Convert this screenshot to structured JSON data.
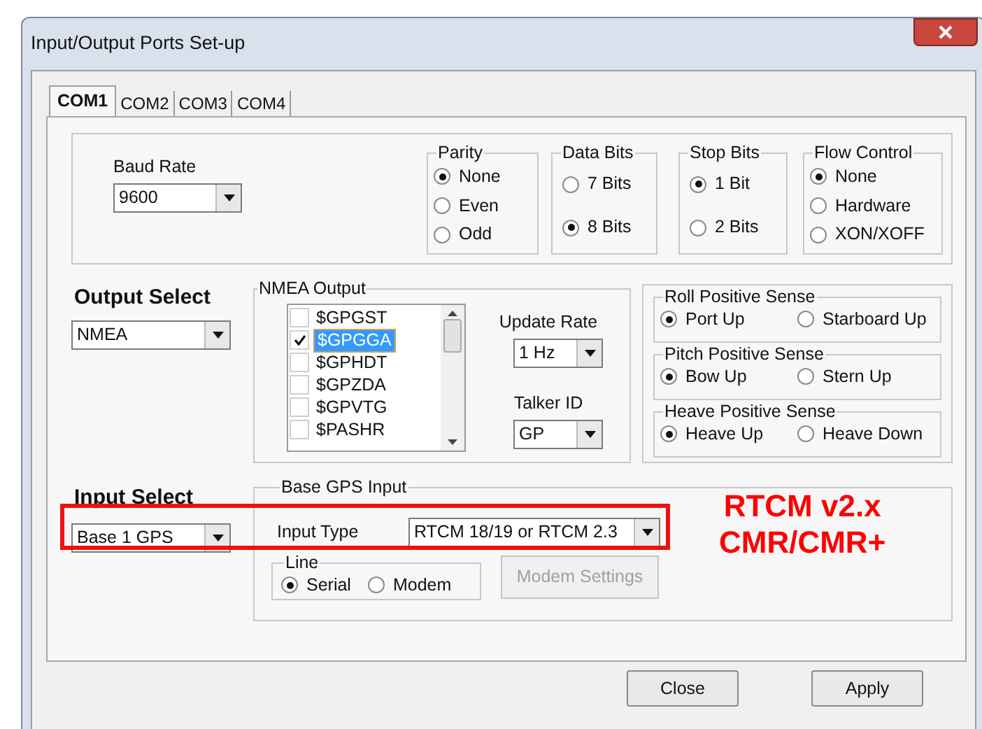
{
  "window": {
    "title": "Input/Output Ports Set-up"
  },
  "tabs": [
    {
      "label": "COM1",
      "selected": true
    },
    {
      "label": "COM2",
      "selected": false
    },
    {
      "label": "COM3",
      "selected": false
    },
    {
      "label": "COM4",
      "selected": false
    }
  ],
  "baud_rate": {
    "label": "Baud Rate",
    "value": "9600"
  },
  "port_groups": [
    {
      "title": "Parity",
      "options": [
        {
          "label": "None",
          "selected": true
        },
        {
          "label": "Even",
          "selected": false
        },
        {
          "label": "Odd",
          "selected": false
        }
      ]
    },
    {
      "title": "Data Bits",
      "options": [
        {
          "label": "7 Bits",
          "selected": false
        },
        {
          "label": "8 Bits",
          "selected": true
        }
      ]
    },
    {
      "title": "Stop Bits",
      "options": [
        {
          "label": "1 Bit",
          "selected": true
        },
        {
          "label": "2 Bits",
          "selected": false
        }
      ]
    },
    {
      "title": "Flow Control",
      "options": [
        {
          "label": "None",
          "selected": true
        },
        {
          "label": "Hardware",
          "selected": false
        },
        {
          "label": "XON/XOFF",
          "selected": false
        }
      ]
    }
  ],
  "output_select": {
    "label": "Output Select",
    "value": "NMEA"
  },
  "nmea_output": {
    "title": "NMEA Output",
    "items": [
      {
        "label": "$GPGST",
        "checked": false,
        "selected": false
      },
      {
        "label": "$GPGGA",
        "checked": true,
        "selected": true
      },
      {
        "label": "$GPHDT",
        "checked": false,
        "selected": false
      },
      {
        "label": "$GPZDA",
        "checked": false,
        "selected": false
      },
      {
        "label": "$GPVTG",
        "checked": false,
        "selected": false
      },
      {
        "label": "$PASHR",
        "checked": false,
        "selected": false
      }
    ]
  },
  "update_rate": {
    "label": "Update Rate",
    "value": "1 Hz"
  },
  "talker_id": {
    "label": "Talker ID",
    "value": "GP"
  },
  "sense_groups": [
    {
      "title": "Roll Positive Sense",
      "options": [
        {
          "label": "Port Up",
          "selected": true
        },
        {
          "label": "Starboard Up",
          "selected": false
        }
      ]
    },
    {
      "title": "Pitch Positive Sense",
      "options": [
        {
          "label": "Bow Up",
          "selected": true
        },
        {
          "label": "Stern Up",
          "selected": false
        }
      ]
    },
    {
      "title": "Heave Positive Sense",
      "options": [
        {
          "label": "Heave Up",
          "selected": true
        },
        {
          "label": "Heave Down",
          "selected": false
        }
      ]
    }
  ],
  "input_select": {
    "label": "Input Select",
    "value": "Base 1 GPS"
  },
  "base_gps_input": {
    "title": "Base GPS Input",
    "input_type": {
      "label": "Input Type",
      "value": "RTCM 18/19 or RTCM 2.3"
    },
    "line": {
      "title": "Line",
      "options": [
        {
          "label": "Serial",
          "selected": true
        },
        {
          "label": "Modem",
          "selected": false
        }
      ]
    },
    "modem_settings": {
      "label": "Modem Settings",
      "disabled": true
    }
  },
  "annotation": {
    "lines": [
      "RTCM v2.x",
      "CMR/CMR+"
    ]
  },
  "buttons": [
    "Close",
    "Apply"
  ]
}
